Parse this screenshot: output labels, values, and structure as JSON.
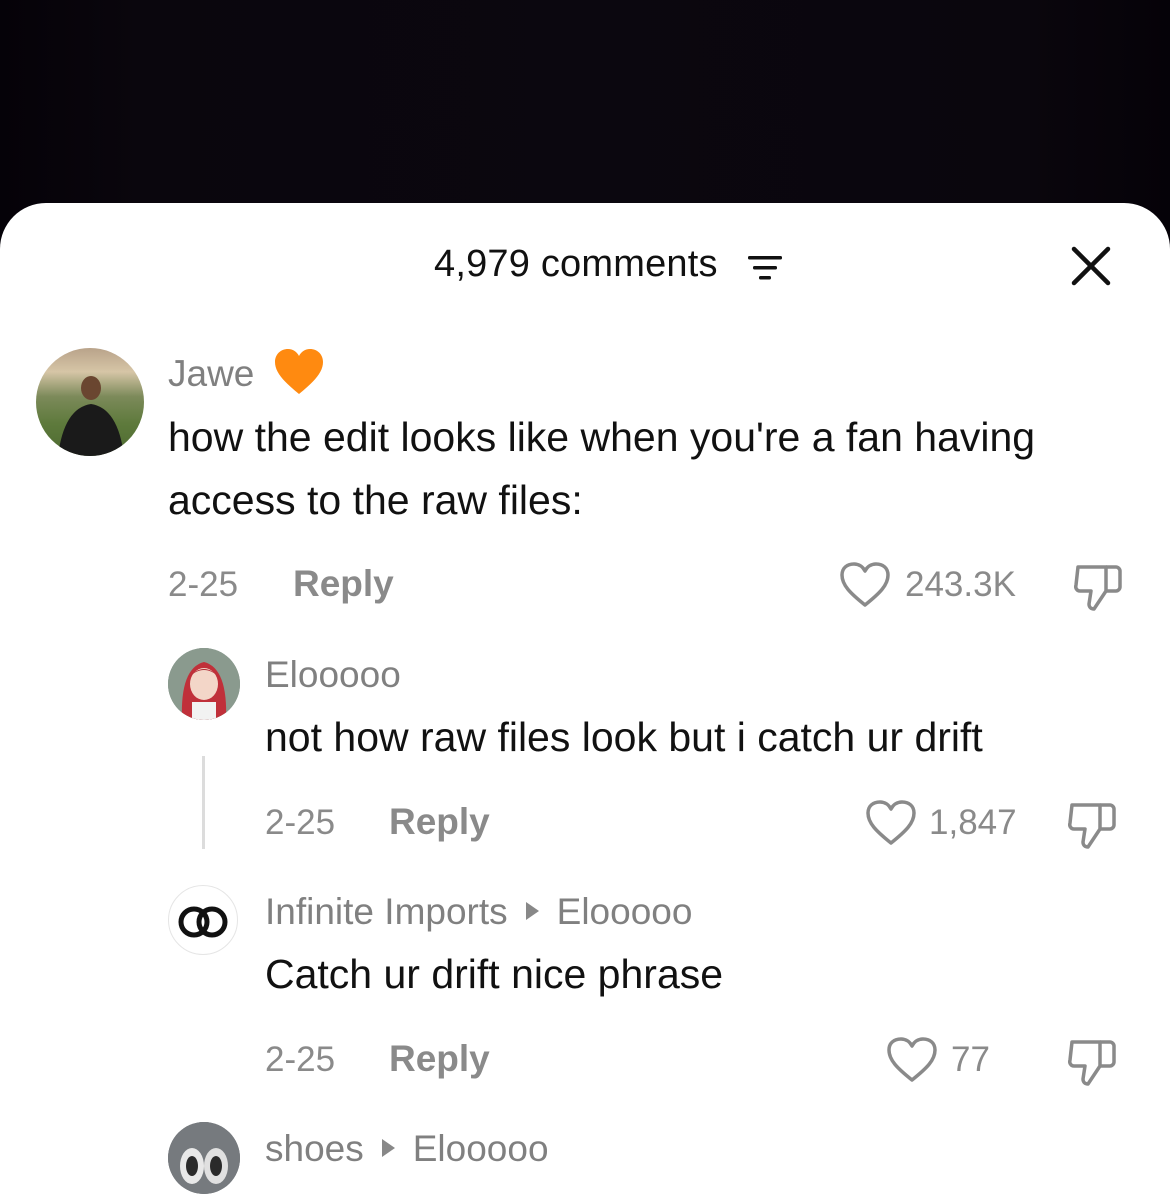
{
  "header": {
    "comment_count": "4,979 comments"
  },
  "comments": [
    {
      "author": "Jawe",
      "text": "how the edit looks like when you're a fan having access to the raw files:",
      "date": "2-25",
      "reply_label": "Reply",
      "likes": "243.3K"
    },
    {
      "author": "Elooooo",
      "text": "not how raw files look but i catch ur drift",
      "date": "2-25",
      "reply_label": "Reply",
      "likes": "1,847"
    },
    {
      "author": "Infinite Imports",
      "reply_to": "Elooooo",
      "text": "Catch ur drift nice phrase",
      "date": "2-25",
      "reply_label": "Reply",
      "likes": "77"
    },
    {
      "author": "shoes",
      "reply_to": "Elooooo"
    }
  ],
  "colors": {
    "heart_emoji": "#ff8a10",
    "muted": "#8a8a8a",
    "text": "#111111"
  }
}
